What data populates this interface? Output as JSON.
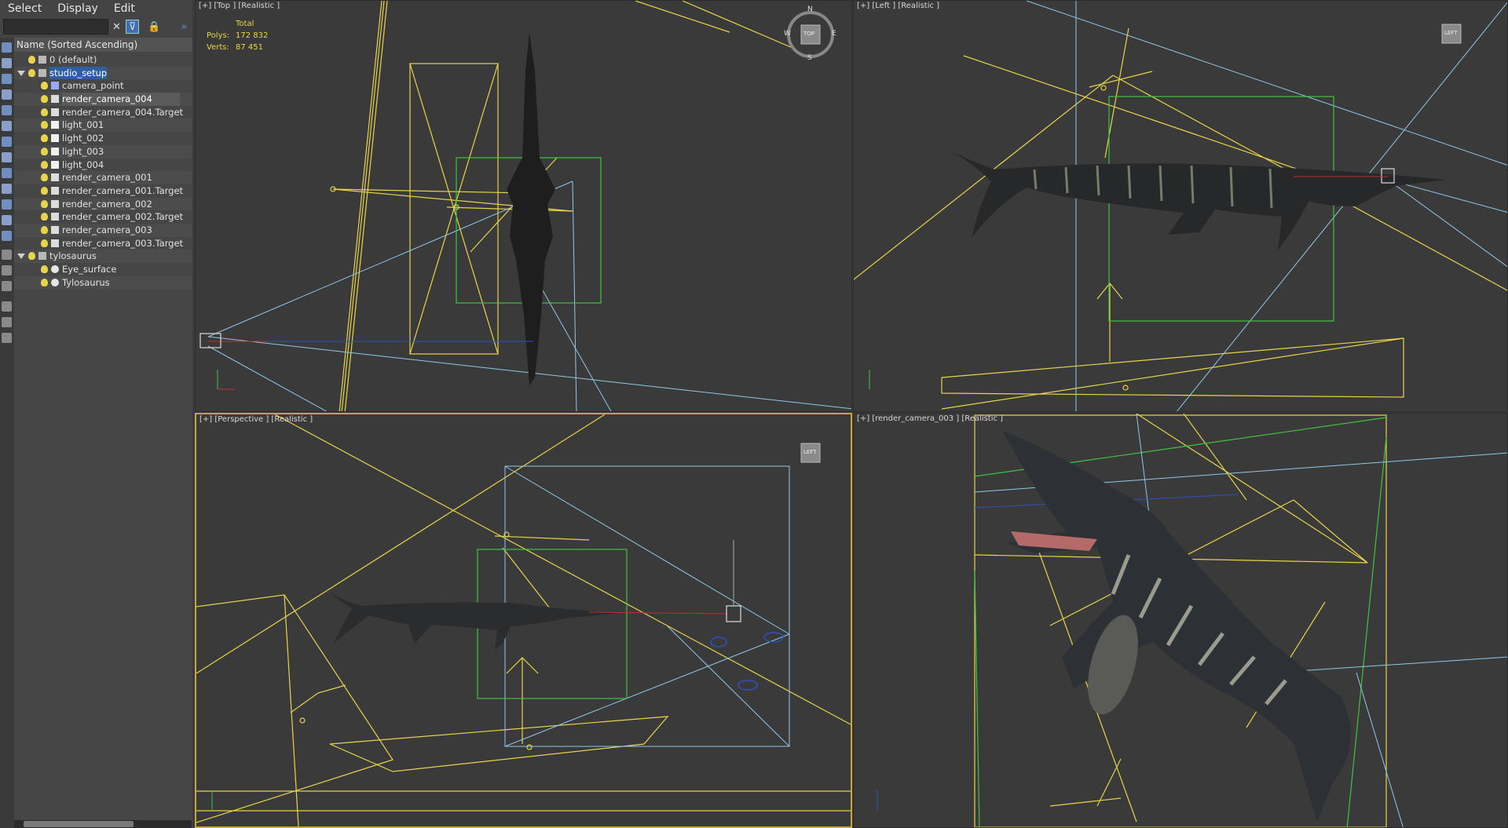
{
  "menubar": {
    "select": "Select",
    "display": "Display",
    "edit": "Edit"
  },
  "explorer": {
    "sort_header": "Name (Sorted Ascending)",
    "rows": [
      {
        "label": "0 (default)",
        "type": "layer"
      },
      {
        "label": "studio_setup",
        "type": "layer"
      },
      {
        "label": "camera_point",
        "type": "point"
      },
      {
        "label": "render_camera_004",
        "type": "camera"
      },
      {
        "label": "render_camera_004.Target",
        "type": "camera"
      },
      {
        "label": "light_001",
        "type": "light"
      },
      {
        "label": "light_002",
        "type": "light"
      },
      {
        "label": "light_003",
        "type": "light"
      },
      {
        "label": "light_004",
        "type": "light"
      },
      {
        "label": "render_camera_001",
        "type": "camera"
      },
      {
        "label": "render_camera_001.Target",
        "type": "camera"
      },
      {
        "label": "render_camera_002",
        "type": "camera"
      },
      {
        "label": "render_camera_002.Target",
        "type": "camera"
      },
      {
        "label": "render_camera_003",
        "type": "camera"
      },
      {
        "label": "render_camera_003.Target",
        "type": "camera"
      },
      {
        "label": "tylosaurus",
        "type": "layer"
      },
      {
        "label": "Eye_surface",
        "type": "geometry"
      },
      {
        "label": "Tylosaurus",
        "type": "geometry"
      }
    ]
  },
  "viewports": {
    "top": {
      "label": "[+] [Top ] [Realistic ]"
    },
    "left": {
      "label": "[+] [Left ] [Realistic ]"
    },
    "perspective": {
      "label": "[+] [Perspective ] [Realistic ]"
    },
    "camera": {
      "label": "[+] [render_camera_003 ] [Realistic ]"
    }
  },
  "stats": {
    "total": "Total",
    "polys_label": "Polys:",
    "polys_value": "172 832",
    "verts_label": "Verts:",
    "verts_value": "87 451"
  },
  "viewcube": {
    "top_face": "TOP",
    "left_face": "LEFT",
    "n": "N",
    "s": "S",
    "e": "E",
    "w": "W"
  },
  "colors": {
    "accent_selection": "#2f5fa3",
    "active_viewport_border": "#c8a832",
    "light_wire": "#e8d44a",
    "camera_wire": "#8fc8e8",
    "bbox_wire": "#3ec43e"
  }
}
